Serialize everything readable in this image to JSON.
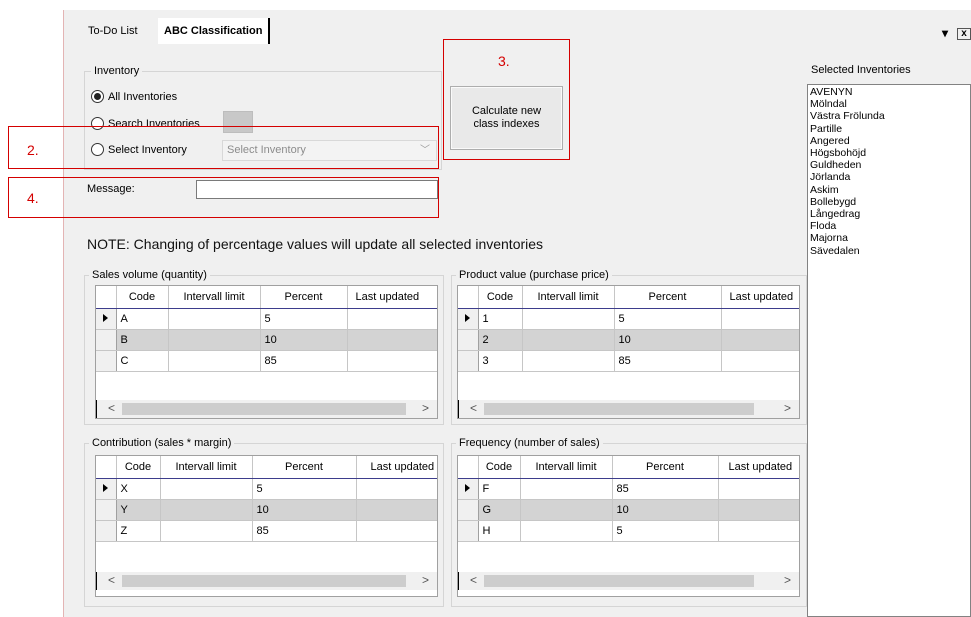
{
  "tabs": [
    {
      "label": "To-Do List"
    },
    {
      "label": "ABC Classification"
    }
  ],
  "window_buttons": {
    "dropdown": "▾",
    "close": "x"
  },
  "inventory": {
    "legend": "Inventory",
    "all_label": "All Inventories",
    "search_label": "Search Inventories",
    "select_label": "Select Inventory",
    "select_placeholder": "Select Inventory",
    "selected_option": "all"
  },
  "calculate_button": {
    "label": "Calculate new class indexes"
  },
  "message": {
    "label": "Message:",
    "value": ""
  },
  "annotations": {
    "two": "2.",
    "three": "3.",
    "four": "4."
  },
  "note": "NOTE: Changing of percentage values will update all selected inventories",
  "selected_inventories": {
    "legend": "Selected Inventories",
    "items": [
      "AVENYN",
      "Mölndal",
      "Västra Frölunda",
      "Partille",
      "Angered",
      "Högsbohöjd",
      "Guldheden",
      "Jörlanda",
      "Askim",
      "Bollebygd",
      "Långedrag",
      "Floda",
      "Majorna",
      "Sävedalen"
    ]
  },
  "grids": {
    "sales": {
      "legend": "Sales volume (quantity)",
      "headers": [
        "Code",
        "Intervall limit",
        "Percent",
        "Last updated"
      ],
      "rows": [
        {
          "code": "A",
          "limit": "",
          "percent": "5"
        },
        {
          "code": "B",
          "limit": "",
          "percent": "10"
        },
        {
          "code": "C",
          "limit": "",
          "percent": "85"
        }
      ]
    },
    "product": {
      "legend": "Product value (purchase price)",
      "headers": [
        "Code",
        "Intervall limit",
        "Percent",
        "Last updated"
      ],
      "rows": [
        {
          "code": "1",
          "limit": "",
          "percent": "5"
        },
        {
          "code": "2",
          "limit": "",
          "percent": "10"
        },
        {
          "code": "3",
          "limit": "",
          "percent": "85"
        }
      ]
    },
    "contribution": {
      "legend": "Contribution (sales * margin)",
      "headers": [
        "Code",
        "Intervall limit",
        "Percent",
        "Last updated"
      ],
      "rows": [
        {
          "code": "X",
          "limit": "",
          "percent": "5"
        },
        {
          "code": "Y",
          "limit": "",
          "percent": "10"
        },
        {
          "code": "Z",
          "limit": "",
          "percent": "85"
        }
      ]
    },
    "frequency": {
      "legend": "Frequency (number of sales)",
      "headers": [
        "Code",
        "Intervall limit",
        "Percent",
        "Last updated"
      ],
      "rows": [
        {
          "code": "F",
          "limit": "",
          "percent": "85"
        },
        {
          "code": "G",
          "limit": "",
          "percent": "10"
        },
        {
          "code": "H",
          "limit": "",
          "percent": "5"
        }
      ]
    }
  },
  "scroll": {
    "left": "<",
    "right": ">"
  }
}
